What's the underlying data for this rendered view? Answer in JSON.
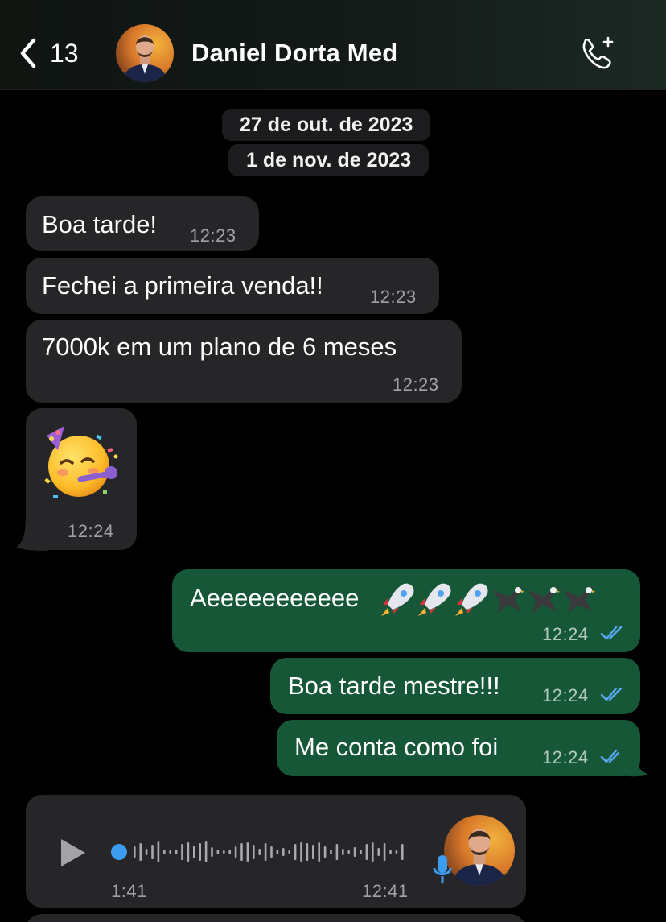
{
  "header": {
    "back_count": "13",
    "contact_name": "Daniel Dorta Med"
  },
  "dates": [
    "27 de out. de 2023",
    "1 de nov. de 2023"
  ],
  "messages": [
    {
      "direction": "in",
      "text": "Boa tarde!",
      "time": "12:23"
    },
    {
      "direction": "in",
      "text": "Fechei a primeira venda!!",
      "time": "12:23"
    },
    {
      "direction": "in",
      "text": "7000k em um plano de 6 meses",
      "time": "12:23"
    },
    {
      "direction": "in",
      "emoji": "partying-face",
      "time": "12:24"
    },
    {
      "direction": "out",
      "text": "Aeeeeeeeeeee",
      "emojis": [
        "rocket",
        "rocket",
        "rocket",
        "eagle",
        "eagle",
        "eagle"
      ],
      "time": "12:24",
      "status": "read"
    },
    {
      "direction": "out",
      "text": "Boa tarde mestre!!!",
      "time": "12:24",
      "status": "read"
    },
    {
      "direction": "out",
      "text": "Me conta como foi",
      "time": "12:24",
      "status": "read"
    }
  ],
  "voice_message": {
    "direction": "in",
    "duration": "1:41",
    "time": "12:41",
    "progress": 0.0
  },
  "colors": {
    "incoming_bubble": "#262628",
    "outgoing_bubble": "#155737",
    "read_ticks": "#5aa9f5",
    "voice_dot": "#3b9cf0"
  }
}
